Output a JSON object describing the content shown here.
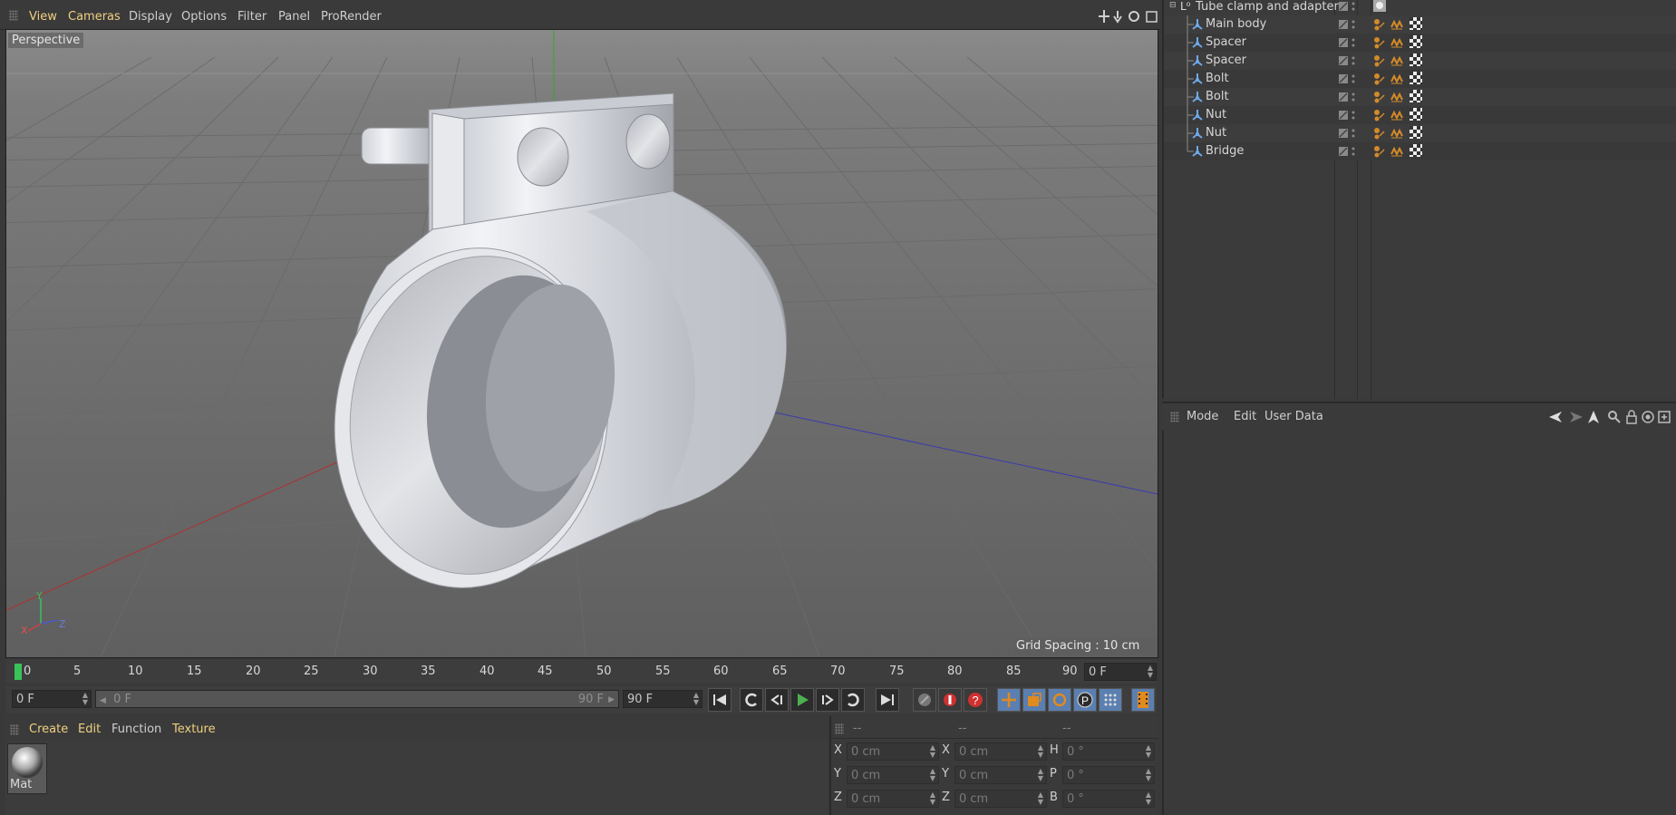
{
  "viewport_menu": {
    "items": [
      "View",
      "Cameras",
      "Display",
      "Options",
      "Filter",
      "Panel",
      "ProRender"
    ]
  },
  "viewport": {
    "label": "Perspective",
    "grid_spacing": "Grid Spacing : 10 cm",
    "axes": {
      "y": "Y",
      "z": "Z",
      "x": "X"
    }
  },
  "timeline": {
    "ticks": [
      "0",
      "5",
      "10",
      "15",
      "20",
      "25",
      "30",
      "35",
      "40",
      "45",
      "50",
      "55",
      "60",
      "65",
      "70",
      "75",
      "80",
      "85",
      "90"
    ],
    "current_frame": "0 F"
  },
  "controls": {
    "start_frame": "0 F",
    "range_start": "0 F",
    "range_end": "90 F",
    "end_frame": "90 F"
  },
  "material_menu": {
    "items": [
      "Create",
      "Edit",
      "Function",
      "Texture"
    ]
  },
  "materials": [
    {
      "name": "Mat"
    }
  ],
  "coordinates": {
    "headers": [
      "--",
      "--",
      "--"
    ],
    "rows": [
      {
        "l1": "X",
        "v1": "0 cm",
        "l2": "X",
        "v2": "0 cm",
        "l3": "H",
        "v3": "0 °"
      },
      {
        "l1": "Y",
        "v1": "0 cm",
        "l2": "Y",
        "v2": "0 cm",
        "l3": "P",
        "v3": "0 °"
      },
      {
        "l1": "Z",
        "v1": "0 cm",
        "l2": "Z",
        "v2": "0 cm",
        "l3": "B",
        "v3": "0 °"
      }
    ]
  },
  "objects": {
    "root": "Tube clamp and adapter",
    "children": [
      "Main body",
      "Spacer",
      "Spacer",
      "Bolt",
      "Bolt",
      "Nut",
      "Nut",
      "Bridge"
    ]
  },
  "attributes_menu": {
    "items": [
      "Mode",
      "Edit",
      "User Data"
    ]
  },
  "colors": {
    "accent_yellow": "#f0d080",
    "selection_orange": "#d28a2a",
    "play_green": "#4caf50",
    "stop_red": "#d03030",
    "frame_green": "#39c25a"
  }
}
